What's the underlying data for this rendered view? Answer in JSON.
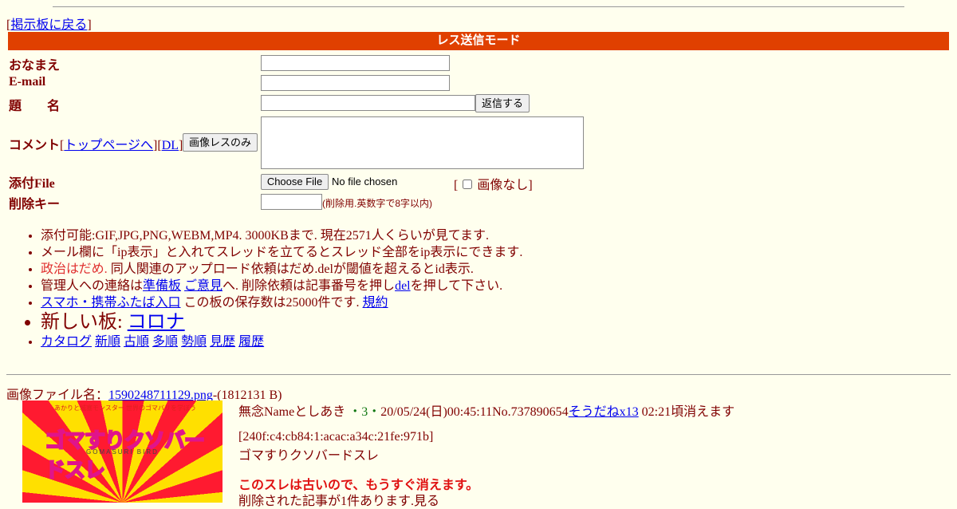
{
  "nav": {
    "bracket_open": "[",
    "back_link": "掲示板に戻る",
    "bracket_close": "]"
  },
  "mode_bar": "レス送信モード",
  "form": {
    "name_label": "おなまえ",
    "email_label": "E-mail",
    "subject_label": "題　　名",
    "submit_label": "返信する",
    "comment_label": "コメント",
    "top_link": "トップページへ",
    "dl_link": "DL",
    "image_only_button": "画像レスのみ",
    "attach_label": "添付File",
    "file_button": "Choose File",
    "file_status": "No file chosen",
    "no_image_open": "[",
    "no_image_label": "画像なし]",
    "delkey_label": "削除キー",
    "delkey_hint": "(削除用.英数字で8字以内)"
  },
  "notes": {
    "line1": "添付可能:GIF,JPG,PNG,WEBM,MP4. 3000KBまで. 現在2571人くらいが見てます.",
    "line2": "メール欄に「ip表示」と入れてスレッドを立てるとスレッド全部をip表示にできます.",
    "line3_red": "政治はだめ.",
    "line3_rest": " 同人関連のアップロード依頼はだめ.delが閾値を超えるとid表示.",
    "line4_a": "管理人への連絡は",
    "line4_link1": "準備板",
    "line4_link2": "ご意見",
    "line4_b": "へ. 削除依頼は記事番号を押し",
    "line4_link3": "del",
    "line4_c": "を押して下さい.",
    "line5_link": "スマホ・携帯ふたば入口",
    "line5_text": " この板の保存数は25000件です. ",
    "line5_link2": "規約",
    "line6_text": "新しい板: ",
    "line6_link": "コロナ",
    "line7_links": [
      "カタログ",
      "新順",
      "古順",
      "多順",
      "勢順",
      "見歴",
      "履歴"
    ]
  },
  "thread": {
    "file_label": "画像ファイル名：",
    "file_link": "1590248711129.png",
    "file_size": "-(1812131 B)",
    "name": "無念Nameとしあき",
    "dot1": " ・",
    "count": "3",
    "dot2": "・",
    "datetime": "20/05/24(日)00:45:11No.737890654",
    "sodane": "そうだねx13",
    "expire": " 02:21頃消えます",
    "ip": "[240f:c4:cb84:1:acac:a34c:21fe:971b]",
    "body": "ゴマすりクソバードスレ",
    "warning": "このスレは古いので、もうすぐ消えます。",
    "deleted": "削除された記事が1件あります.見る"
  },
  "thumbnail": {
    "subtitle": "あかりと城塞モンスター 世界のゴマバリを学ぼう",
    "title": "ゴマすりクソバードスレ",
    "subtitle_en": "GOMASURI BIRD"
  },
  "colors": {
    "mode_bar": "#e04000",
    "background": "#ffffee",
    "text": "#800000",
    "link": "#0000ee"
  }
}
